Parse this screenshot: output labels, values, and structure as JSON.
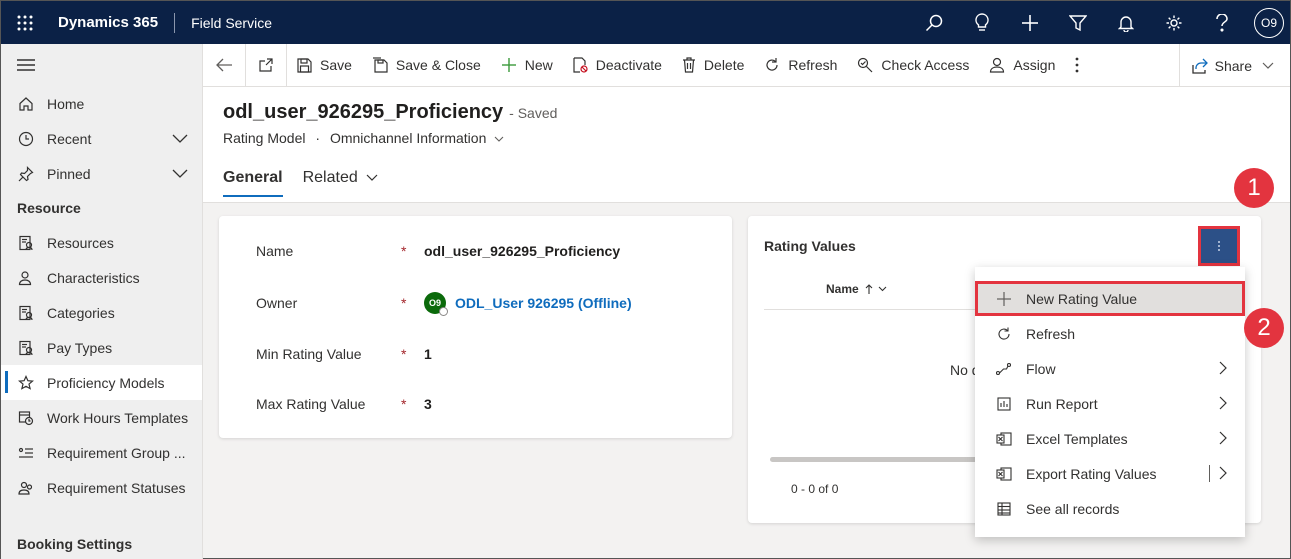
{
  "topbar": {
    "app_name": "Dynamics 365",
    "module_name": "Field Service",
    "avatar_initials": "O9"
  },
  "sidebar": {
    "top_items": [
      {
        "label": "Home",
        "icon": "home-icon"
      },
      {
        "label": "Recent",
        "icon": "clock-icon"
      },
      {
        "label": "Pinned",
        "icon": "pin-icon"
      }
    ],
    "group_resource": "Resource",
    "resource_items": [
      {
        "label": "Resources",
        "icon": "resource-icon"
      },
      {
        "label": "Characteristics",
        "icon": "person-icon"
      },
      {
        "label": "Categories",
        "icon": "resource-icon"
      },
      {
        "label": "Pay Types",
        "icon": "resource-icon"
      },
      {
        "label": "Proficiency Models",
        "icon": "star-icon",
        "active": true
      },
      {
        "label": "Work Hours Templates",
        "icon": "calendar-clock-icon"
      },
      {
        "label": "Requirement Group ...",
        "icon": "list-icon"
      },
      {
        "label": "Requirement Statuses",
        "icon": "people-icon"
      }
    ],
    "group_booking": "Booking Settings"
  },
  "commandbar": {
    "save": "Save",
    "save_close": "Save & Close",
    "new": "New",
    "deactivate": "Deactivate",
    "delete": "Delete",
    "refresh": "Refresh",
    "check_access": "Check Access",
    "assign": "Assign",
    "share": "Share"
  },
  "header": {
    "title": "odl_user_926295_Proficiency",
    "saved_status": "- Saved",
    "entity": "Rating Model",
    "separator": "·",
    "form_name": "Omnichannel Information",
    "tabs": [
      "General",
      "Related"
    ]
  },
  "form": {
    "required_mark": "*",
    "name_label": "Name",
    "name_value": "odl_user_926295_Proficiency",
    "owner_label": "Owner",
    "owner_initials": "O9",
    "owner_value": "ODL_User 926295 (Offline)",
    "min_label": "Min Rating Value",
    "min_value": "1",
    "max_label": "Max Rating Value",
    "max_value": "3"
  },
  "rating_values": {
    "title": "Rating Values",
    "col_name": "Name",
    "empty_text": "No d",
    "pager": "0 - 0 of 0"
  },
  "menu": {
    "items": [
      {
        "label": "New Rating Value",
        "icon": "plus-icon"
      },
      {
        "label": "Refresh",
        "icon": "refresh-icon"
      },
      {
        "label": "Flow",
        "icon": "flow-icon"
      },
      {
        "label": "Run Report",
        "icon": "report-icon"
      },
      {
        "label": "Excel Templates",
        "icon": "excel-icon"
      },
      {
        "label": "Export Rating Values",
        "icon": "excel-icon"
      },
      {
        "label": "See all records",
        "icon": "table-icon"
      }
    ]
  },
  "callouts": {
    "one": "1",
    "two": "2"
  },
  "colors": {
    "topbar": "#0b2146",
    "accent": "#0f6cbd",
    "callout_red": "#e3343f",
    "more_button": "#2c5087"
  }
}
